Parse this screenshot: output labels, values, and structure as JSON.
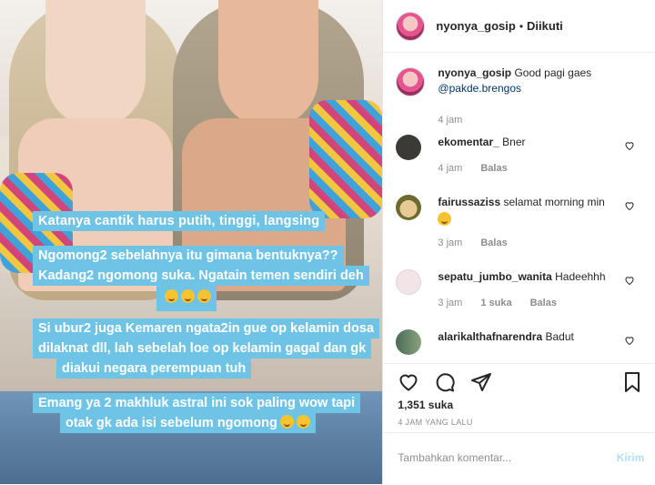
{
  "post": {
    "captions": [
      [
        "Katanya cantik harus putih, tinggi, langsing"
      ],
      [
        "Ngomong2 sebelahnya itu gimana bentuknya??",
        "Kadang2 ngomong suka. Ngatain temen sendiri deh"
      ],
      [
        "Si ubur2 juga Kemaren ngata2in gue op kelamin dosa",
        "dilaknat dll, lah sebelah loe op kelamin gagal dan gk",
        "diakui negara perempuan tuh"
      ],
      [
        "Emang ya 2 makhluk astral ini sok paling wow tapi",
        "otak gk ada isi sebelum ngomong"
      ]
    ]
  },
  "header": {
    "username": "nyonya_gosip",
    "dot": "•",
    "follow_status": "Diikuti"
  },
  "caption_comment": {
    "username": "nyonya_gosip",
    "text": "Good pagi gaes",
    "mention": "@pakde.brengos",
    "time": "4 jam"
  },
  "comments": [
    {
      "username": "ekomentar_",
      "text": "Bner",
      "time": "4 jam",
      "likes": "",
      "reply": "Balas",
      "avatar_color": "#3c3a36"
    },
    {
      "username": "fairussaziss",
      "text": "selamat morning min",
      "time": "3 jam",
      "likes": "",
      "reply": "Balas",
      "avatar_color": "#f0d7a2"
    },
    {
      "username": "sepatu_jumbo_wanita",
      "text": "Hadeehhh",
      "time": "3 jam",
      "likes": "1 suka",
      "reply": "Balas",
      "avatar_color": "#f3e4e8"
    },
    {
      "username": "alarikalthafnarendra",
      "text": "Badut",
      "time": "",
      "likes": "",
      "reply": "",
      "avatar_color": "#4a6b57"
    }
  ],
  "actions": {
    "likes_count": "1,351 suka",
    "posted_time": "4 JAM YANG LALU"
  },
  "add_comment": {
    "placeholder": "Tambahkan komentar...",
    "post_label": "Kirim"
  },
  "colors": {
    "caption_bg": "#6fc4e6",
    "link": "#00376b",
    "muted": "#8e8e8e"
  }
}
